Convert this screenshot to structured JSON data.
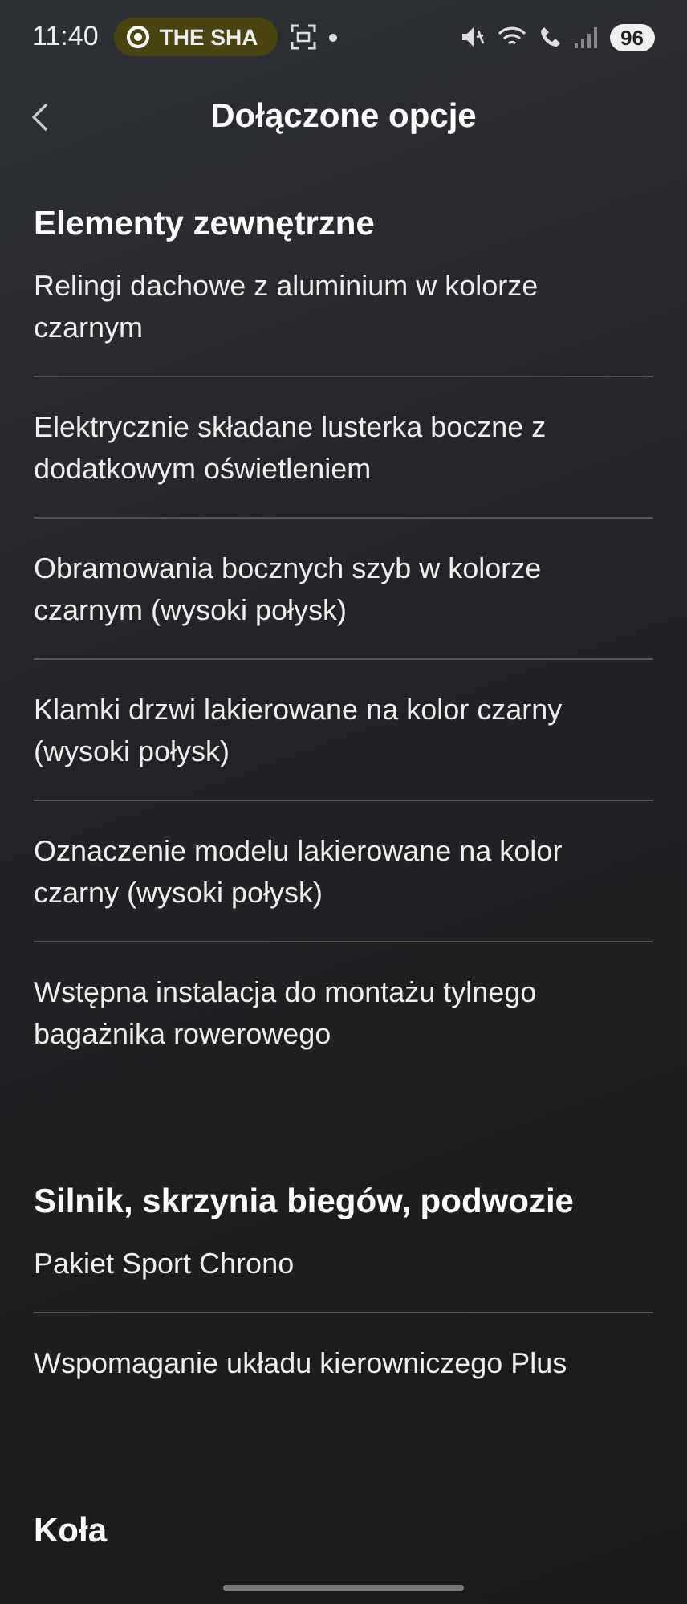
{
  "status_bar": {
    "time": "11:40",
    "notification": "THE SHA",
    "battery": "96"
  },
  "header": {
    "title": "Dołączone opcje"
  },
  "sections": [
    {
      "title": "Elementy zewnętrzne",
      "items": [
        "Relingi dachowe z aluminium w kolorze czarnym",
        "Elektrycznie składane lusterka boczne z dodatkowym oświetleniem",
        "Obramowania bocznych szyb w kolorze czarnym (wysoki połysk)",
        "Klamki drzwi lakierowane na kolor czarny (wysoki połysk)",
        "Oznaczenie modelu lakierowane na kolor czarny (wysoki połysk)",
        "Wstępna instalacja do montażu tylnego bagażnika rowerowego"
      ]
    },
    {
      "title": "Silnik, skrzynia biegów, podwozie",
      "items": [
        "Pakiet Sport Chrono",
        "Wspomaganie układu kierowniczego Plus"
      ]
    },
    {
      "title": "Koła"
    }
  ]
}
